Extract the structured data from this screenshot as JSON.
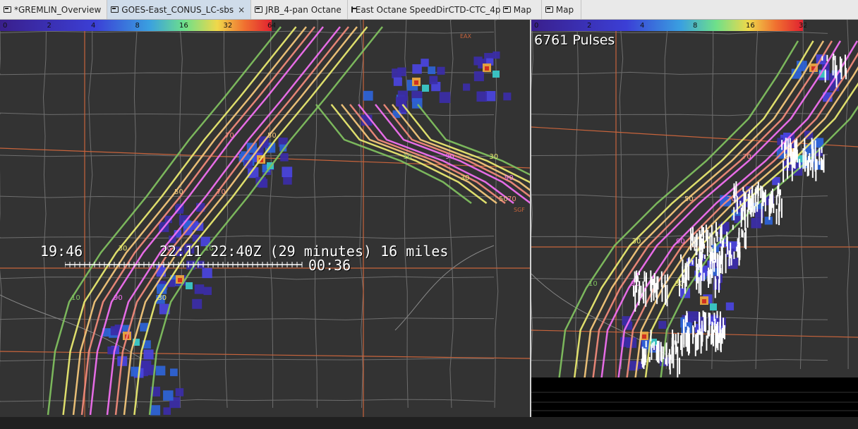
{
  "tabs": [
    {
      "label": "*GREMLIN_Overview"
    },
    {
      "label": "GOES-East_CONUS_LC-sbs",
      "close": "×"
    },
    {
      "label": "JRB_4-pan Octane"
    },
    {
      "label": "East Octane SpeedDirCTD-CTC_4p"
    },
    {
      "label": "Map"
    },
    {
      "label": "Map"
    }
  ],
  "left_pane": {
    "colorbar_ticks": [
      "0",
      "2",
      "4",
      "8",
      "16",
      "32",
      "64"
    ],
    "time_start": "19:46",
    "time_range": "22:11 22:40Z (29 minutes) 16 miles",
    "time_end": "00:36",
    "contour_labels": [
      "10",
      "30",
      "50",
      "70",
      "90"
    ],
    "station_labels": [
      "EAX",
      "SGF"
    ]
  },
  "right_pane": {
    "colorbar_ticks": [
      "0",
      "2",
      "4",
      "8",
      "16",
      "32"
    ],
    "pulses": "6761 Pulses"
  },
  "colors": {
    "contour_10": "#7fbf5f",
    "contour_30": "#e8e870",
    "contour_50": "#f2c67a",
    "contour_70": "#f08a7a",
    "contour_90": "#f070f0",
    "borders": "#c8643c",
    "counties": "#6e6e6e",
    "background": "#333333"
  }
}
